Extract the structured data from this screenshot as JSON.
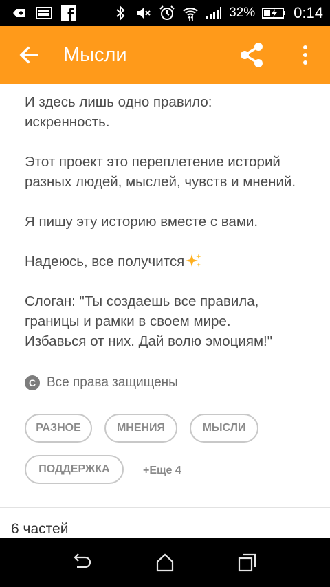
{
  "status_bar": {
    "battery_percent": "32%",
    "time": "0:14"
  },
  "app_bar": {
    "title": "Мысли"
  },
  "description": {
    "paragraphs": [
      "И здесь лишь одно правило:\nискренность.",
      "Этот проект это переплетение историй\nразных людей, мыслей, чувств и мнений.",
      "Я пишу эту историю вместе с вами.",
      "Надеюсь, все получится",
      "Слоган: \"Ты создаешь все правила,\nграницы и рамки в своем мире.\nИзбавься от них. Дай волю эмоциям!\""
    ]
  },
  "copyright": {
    "icon_letter": "C",
    "text": "Все права защищены"
  },
  "tags": [
    "РАЗНОЕ",
    "МНЕНИЯ",
    "МЫСЛИ",
    "ПОДДЕРЖКА"
  ],
  "more_tags": "+Еще 4",
  "parts_label": "6 частей",
  "colors": {
    "accent": "#ff9a1a",
    "text": "#4d4d4d",
    "tag_border": "#c8c8c8",
    "sparkle": "#ffb020"
  },
  "icons": {
    "back": "arrow-left-icon",
    "share": "share-icon",
    "more": "more-vert-icon",
    "sparkle": "sparkles-icon",
    "nav_back": "nav-back-icon",
    "nav_home": "nav-home-icon",
    "nav_recents": "nav-recents-icon"
  }
}
